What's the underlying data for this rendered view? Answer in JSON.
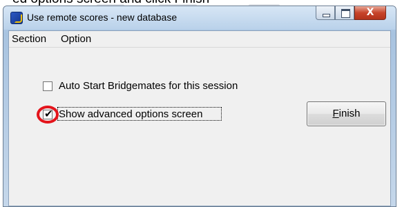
{
  "caption": "ed options screen and click Finish",
  "window": {
    "title": "Use remote scores - new database",
    "close_glyph": "X"
  },
  "menu": {
    "items": [
      {
        "label": "Section"
      },
      {
        "label": "Option"
      }
    ]
  },
  "options": {
    "auto_start": {
      "label": "Auto Start Bridgemates for this session",
      "checked": false
    },
    "advanced": {
      "label": "Show advanced options screen",
      "checked": true,
      "check_glyph": "✔"
    }
  },
  "finish_button": {
    "mnemonic": "F",
    "rest": "inish"
  },
  "colors": {
    "annotation_circle": "#e3141b",
    "title_gradient_top": "#d7e6f5",
    "close_button": "#c7442a"
  }
}
